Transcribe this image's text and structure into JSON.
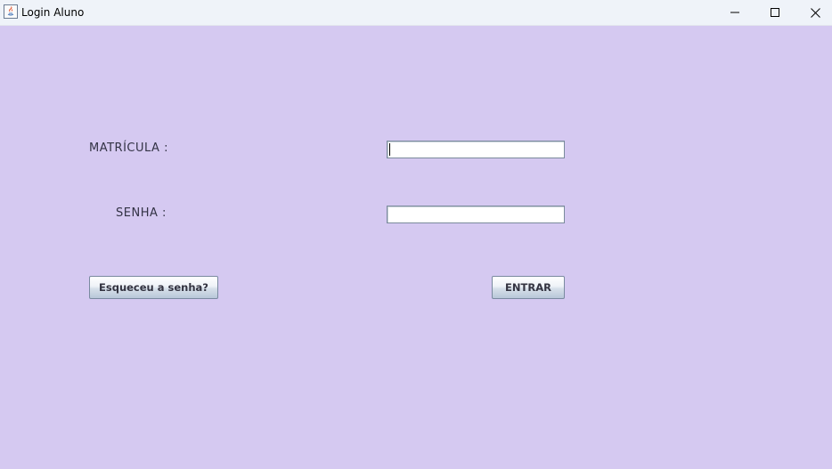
{
  "window": {
    "title": "Login Aluno",
    "app_icon": "java-icon",
    "controls": [
      "minimize-icon",
      "maximize-icon",
      "close-icon"
    ],
    "background_color": "#d5c9f1"
  },
  "form": {
    "matricula": {
      "label": "MATRÍCULA :",
      "value": ""
    },
    "senha": {
      "label": "SENHA :",
      "value": ""
    },
    "forgot_button_label": "Esqueceu a senha?",
    "enter_button_label": "ENTRAR"
  }
}
